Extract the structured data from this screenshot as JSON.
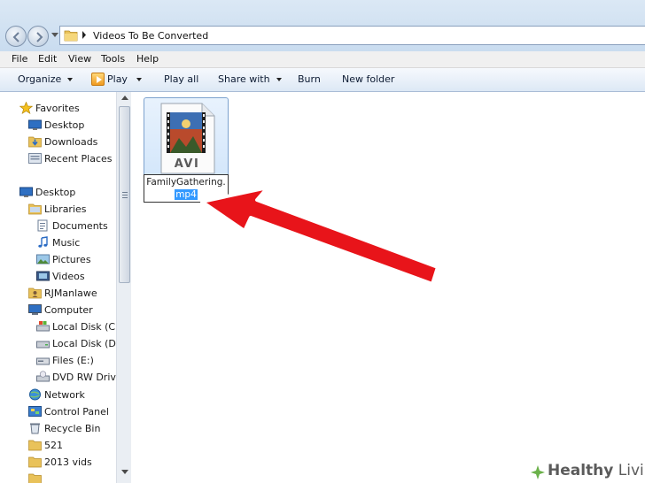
{
  "address": {
    "path": "Videos To Be Converted"
  },
  "menu": [
    "File",
    "Edit",
    "View",
    "Tools",
    "Help"
  ],
  "toolbar": {
    "organize": "Organize",
    "play": "Play",
    "play_all": "Play all",
    "share_with": "Share with",
    "burn": "Burn",
    "new_folder": "New folder"
  },
  "nav": {
    "favorites": "Favorites",
    "desktop_fav": "Desktop",
    "downloads": "Downloads",
    "recent_places": "Recent Places",
    "desktop": "Desktop",
    "libraries": "Libraries",
    "documents": "Documents",
    "music": "Music",
    "pictures": "Pictures",
    "videos": "Videos",
    "user": "RJManlawe",
    "computer": "Computer",
    "local_c": "Local Disk (C:)",
    "local_d": "Local Disk (D:)",
    "files_e": "Files (E:)",
    "dvd": "DVD RW Drive (",
    "network": "Network",
    "control_panel": "Control Panel",
    "recycle_bin": "Recycle Bin",
    "folder_521": "521",
    "folder_2013": "2013 vids"
  },
  "file": {
    "icon_label": "AVI",
    "name_base": "FamilyGathering.",
    "name_ext": "mp4"
  },
  "watermark": {
    "prefix": "Healthy",
    "suffix": " Living"
  },
  "colors": {
    "arrow": "#e8141a",
    "selection": "#3399ff",
    "watermark": "#5b5b5b"
  }
}
